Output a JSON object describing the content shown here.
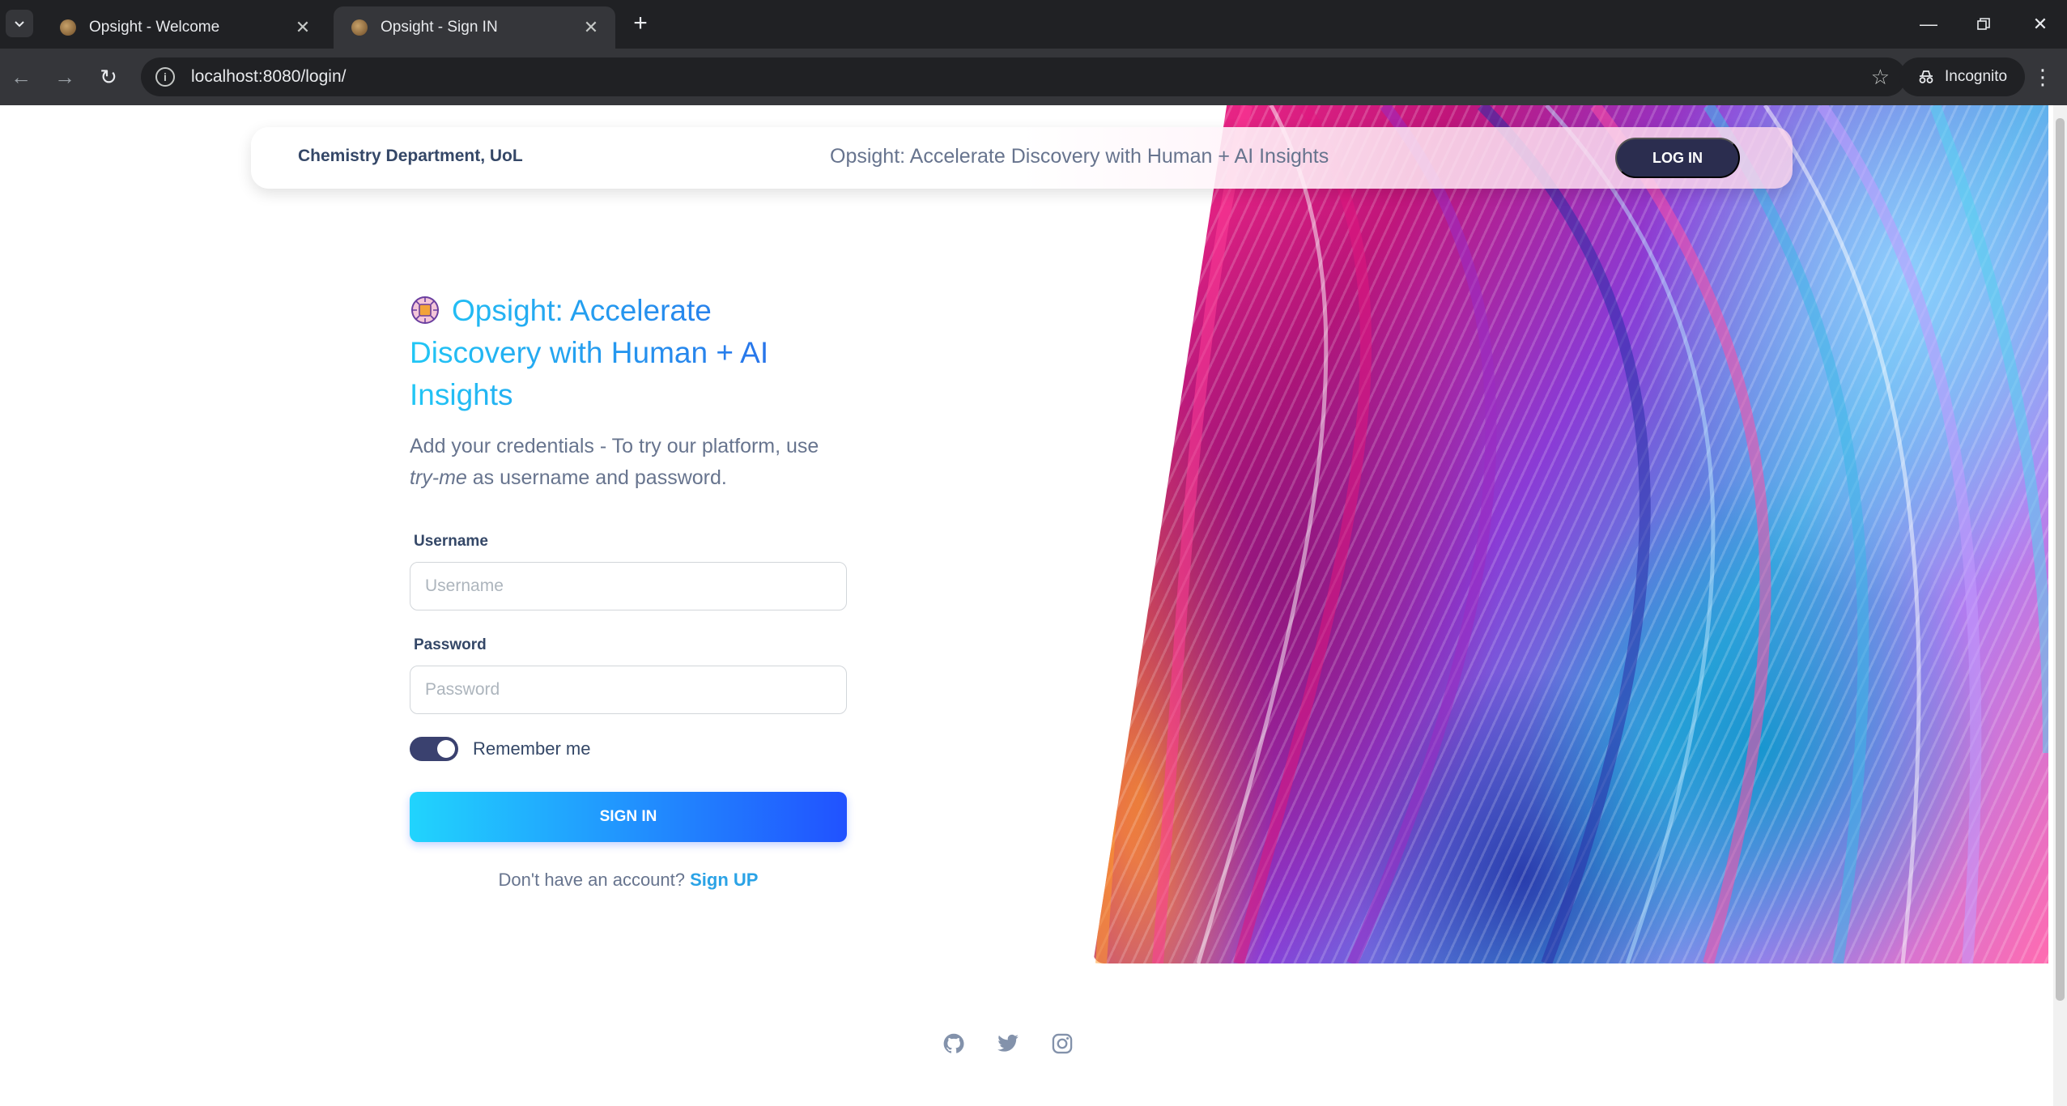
{
  "browser": {
    "tabs": [
      {
        "title": "Opsight - Welcome",
        "active": false
      },
      {
        "title": "Opsight - Sign IN",
        "active": true
      }
    ],
    "url": "localhost:8080/login/",
    "incognito_label": "Incognito"
  },
  "navbar": {
    "brand": "Chemistry Department, UoL",
    "slogan": "Opsight: Accelerate Discovery with Human + AI Insights",
    "login_label": "LOG IN"
  },
  "form": {
    "heading": "Opsight: Accelerate Discovery with Human + AI Insights",
    "subtitle_prefix": "Add your credentials - To try our platform, use ",
    "subtitle_em": "try-me",
    "subtitle_suffix": " as username and password.",
    "username_label": "Username",
    "username_placeholder": "Username",
    "password_label": "Password",
    "password_placeholder": "Password",
    "remember_label": "Remember me",
    "remember_on": true,
    "submit_label": "SIGN IN",
    "signup_prompt": "Don't have an account? ",
    "signup_link": "Sign UP"
  },
  "footer": {
    "icons": [
      "github-icon",
      "twitter-icon",
      "instagram-icon"
    ]
  },
  "colors": {
    "accent_gradient": [
      "#21d4fd",
      "#2152ff"
    ],
    "dark_button": "#2b2d4f",
    "text_primary": "#344767",
    "text_secondary": "#67748e"
  }
}
